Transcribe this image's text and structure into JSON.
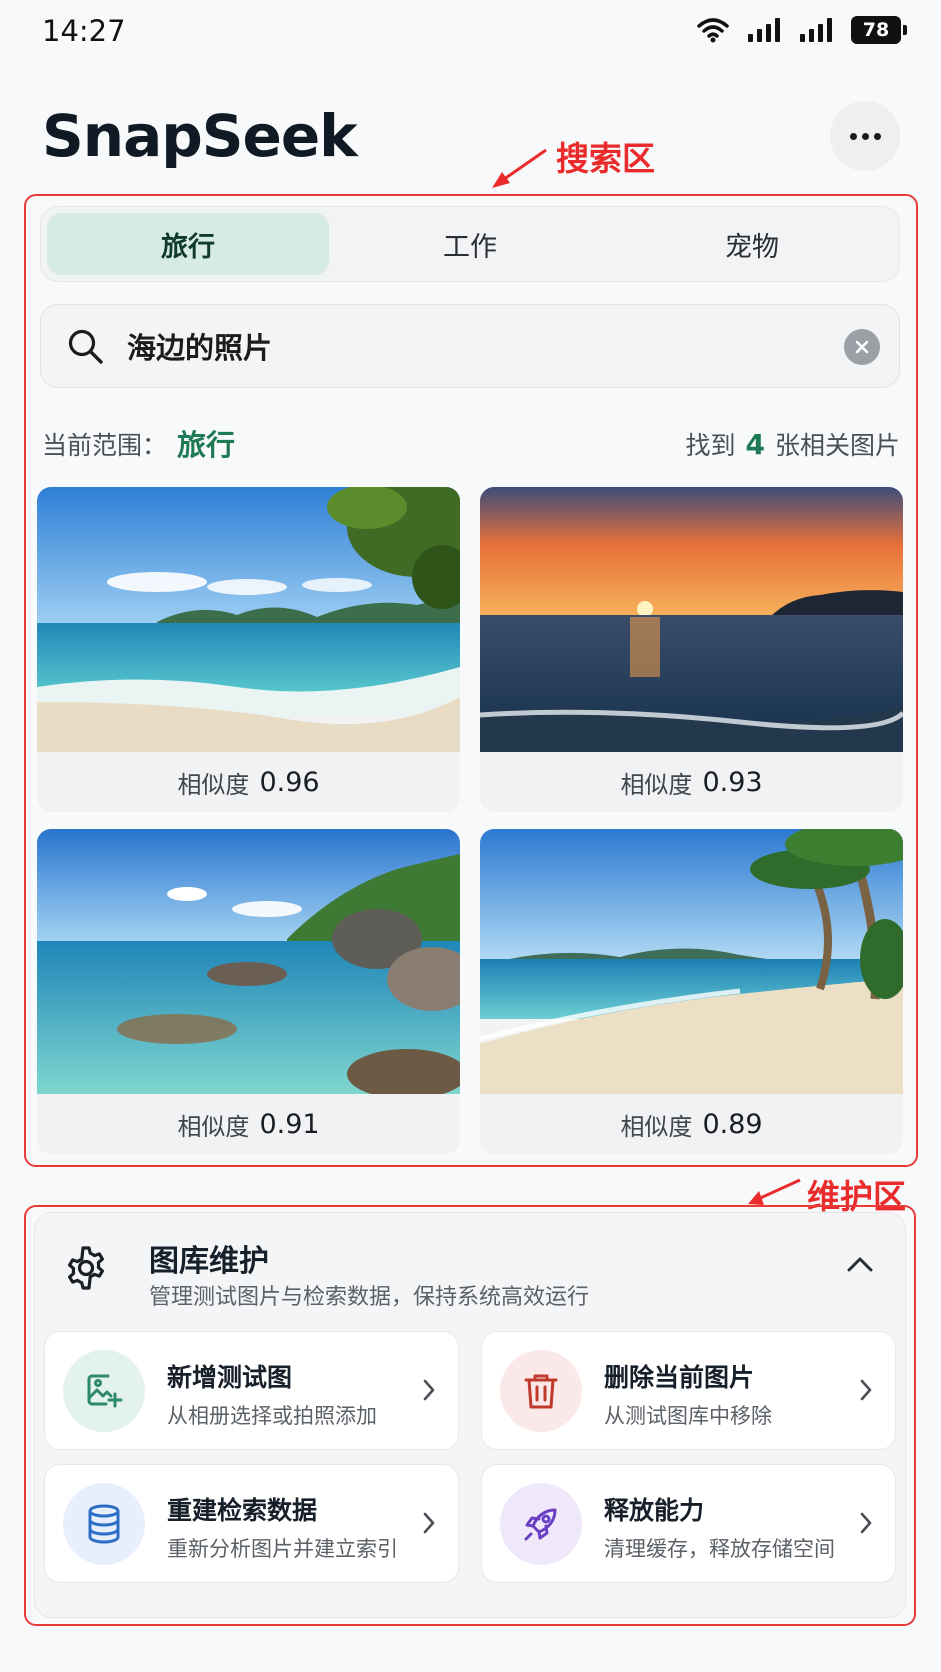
{
  "status_bar": {
    "time": "14:27",
    "battery": "78"
  },
  "header": {
    "title": "SnapSeek"
  },
  "annotations": {
    "search_area": "搜索区",
    "maintenance_area": "维护区"
  },
  "tabs": [
    {
      "label": "旅行",
      "active": true
    },
    {
      "label": "工作",
      "active": false
    },
    {
      "label": "宠物",
      "active": false
    }
  ],
  "search": {
    "query": "海边的照片"
  },
  "scope": {
    "label": "当前范围：",
    "value": "旅行"
  },
  "results": {
    "prefix": "找到",
    "count": "4",
    "suffix": "张相关图片"
  },
  "cards": [
    {
      "sim_label": "相似度",
      "sim_value": "0.96"
    },
    {
      "sim_label": "相似度",
      "sim_value": "0.93"
    },
    {
      "sim_label": "相似度",
      "sim_value": "0.91"
    },
    {
      "sim_label": "相似度",
      "sim_value": "0.89"
    }
  ],
  "maintenance": {
    "title": "图库维护",
    "subtitle": "管理测试图片与检索数据，保持系统高效运行",
    "actions": [
      {
        "title": "新增测试图",
        "desc": "从相册选择或拍照添加",
        "icon": "add-image-icon",
        "color": "#2e8a66"
      },
      {
        "title": "删除当前图片",
        "desc": "从测试图库中移除",
        "icon": "trash-icon",
        "color": "#c0392b"
      },
      {
        "title": "重建检索数据",
        "desc": "重新分析图片并建立索引",
        "icon": "database-icon",
        "color": "#2d6fc4"
      },
      {
        "title": "释放能力",
        "desc": "清理缓存，释放存储空间",
        "icon": "rocket-icon",
        "color": "#6a3fc2"
      }
    ]
  }
}
